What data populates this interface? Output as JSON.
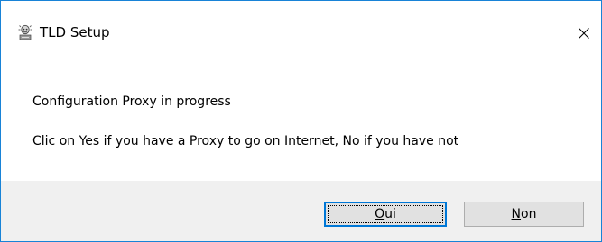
{
  "window": {
    "title": "TLD Setup",
    "icon": "installer-app-icon",
    "close_icon": "close-icon"
  },
  "message": {
    "line1": "Configuration Proxy in progress",
    "line2": "Clic on Yes if you have a Proxy to go on Internet, No if you have not"
  },
  "buttons": {
    "yes": {
      "mnemonic": "O",
      "rest": "ui"
    },
    "no": {
      "mnemonic": "N",
      "rest": "on"
    }
  },
  "colors": {
    "window_border": "#1883d7",
    "footer_bg": "#f0f0f0",
    "button_bg": "#e1e1e1",
    "button_border": "#adadad",
    "default_button_border": "#0078d7"
  }
}
